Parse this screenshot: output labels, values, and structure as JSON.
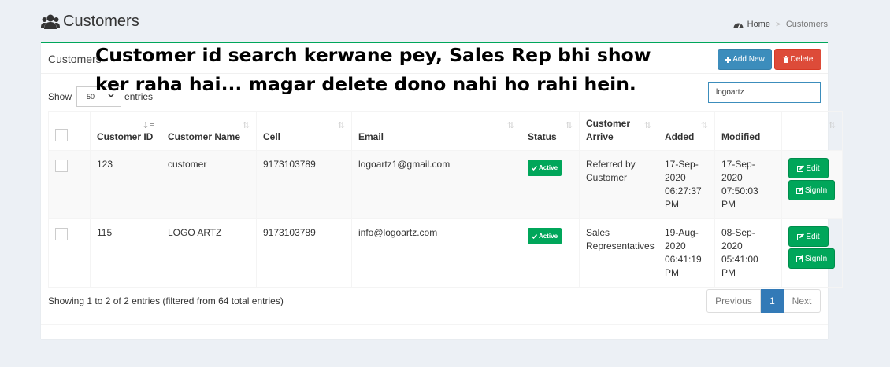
{
  "header": {
    "title": "Customers"
  },
  "breadcrumb": {
    "home": "Home",
    "current": "Customers",
    "separator": ">"
  },
  "box": {
    "title": "Customers",
    "add_label": "Add New",
    "delete_label": "Delete"
  },
  "length": {
    "show_label": "Show",
    "value": "50",
    "entries_label": "entries"
  },
  "search": {
    "value": "logoartz"
  },
  "table": {
    "columns": [
      "Customer ID",
      "Customer Name",
      "Cell",
      "Email",
      "Status",
      "Customer Arrive",
      "Added",
      "Modified",
      ""
    ],
    "rows": [
      {
        "id": "123",
        "name": "customer",
        "cell": "9173103789",
        "email": "logoartz1@gmail.com",
        "status": "Active",
        "arrive": "Referred by Customer",
        "added": "17-Sep-2020 06:27:37 PM",
        "modified": "17-Sep-2020 07:50:03 PM",
        "edit": "Edit",
        "signin": "SignIn"
      },
      {
        "id": "115",
        "name": "LOGO ARTZ",
        "cell": "9173103789",
        "email": "info@logoartz.com",
        "status": "Active",
        "arrive": "Sales Representatives",
        "added": "19-Aug-2020 06:41:19 PM",
        "modified": "08-Sep-2020 05:41:00 PM",
        "edit": "Edit",
        "signin": "SignIn"
      }
    ]
  },
  "info": "Showing 1 to 2 of 2 entries (filtered from 64 total entries)",
  "pagination": {
    "previous": "Previous",
    "current": "1",
    "next": "Next"
  },
  "annotation": {
    "line1": "Customer id search kerwane pey, Sales Rep bhi show",
    "line2": "ker raha hai...  magar delete dono nahi ho rahi hein."
  },
  "colors": {
    "primary": "#3c8dbc",
    "danger": "#dd4b39",
    "success": "#00a65a",
    "page_bg": "#ecf0f5"
  }
}
